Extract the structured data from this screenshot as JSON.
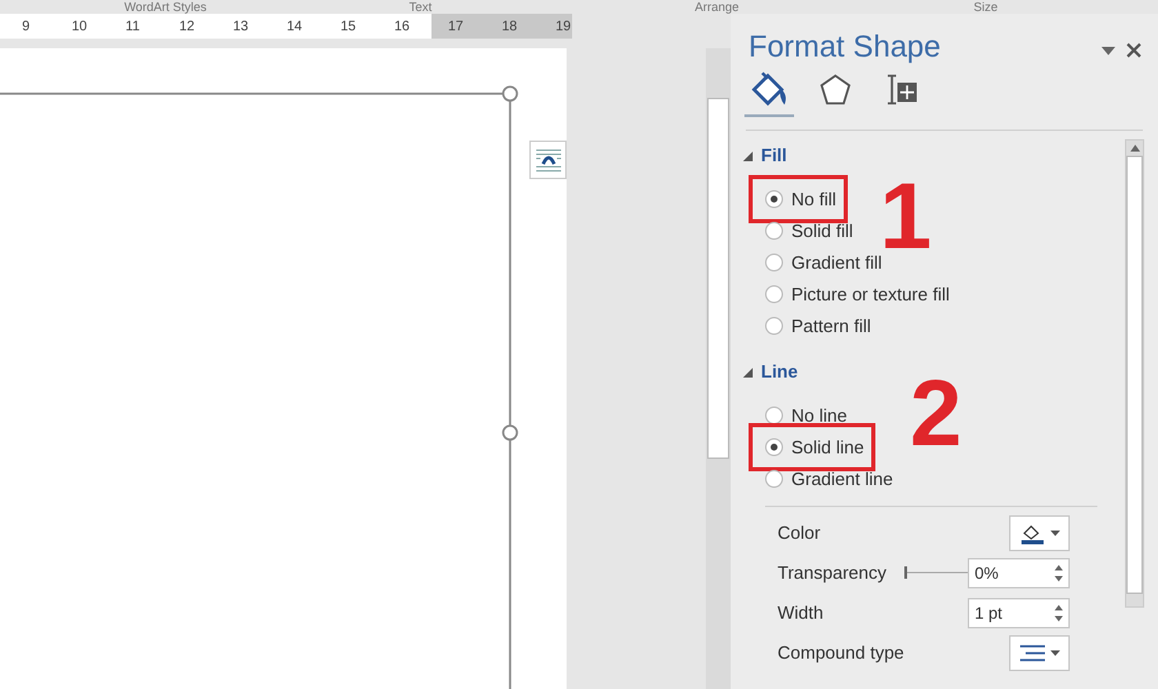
{
  "ribbon_groups": [
    "WordArt Styles",
    "Text",
    "Arrange",
    "Size"
  ],
  "ruler": {
    "numbers": [
      "9",
      "10",
      "11",
      "12",
      "13",
      "14",
      "15",
      "16",
      "17",
      "18",
      "19"
    ]
  },
  "panel": {
    "title": "Format Shape",
    "tabs": [
      {
        "kind": "fill",
        "selected": true
      },
      {
        "kind": "effects",
        "selected": false
      },
      {
        "kind": "layout",
        "selected": false
      }
    ],
    "sections": [
      {
        "title": "Fill",
        "expanded": true,
        "annotation": "1",
        "options": [
          {
            "label": "No fill",
            "selected": true
          },
          {
            "label": "Solid fill",
            "selected": false
          },
          {
            "label": "Gradient fill",
            "selected": false
          },
          {
            "label": "Picture or texture fill",
            "selected": false
          },
          {
            "label": "Pattern fill",
            "selected": false
          }
        ]
      },
      {
        "title": "Line",
        "expanded": true,
        "annotation": "2",
        "options": [
          {
            "label": "No line",
            "selected": false
          },
          {
            "label": "Solid line",
            "selected": true
          },
          {
            "label": "Gradient line",
            "selected": false
          }
        ],
        "settings": [
          {
            "kind": "color",
            "label": "Color"
          },
          {
            "kind": "slider",
            "label": "Transparency",
            "level": 0,
            "value": "0%"
          },
          {
            "kind": "spin",
            "label": "Width",
            "value": "1 pt"
          },
          {
            "kind": "lines",
            "label": "Compound type"
          }
        ]
      }
    ]
  }
}
